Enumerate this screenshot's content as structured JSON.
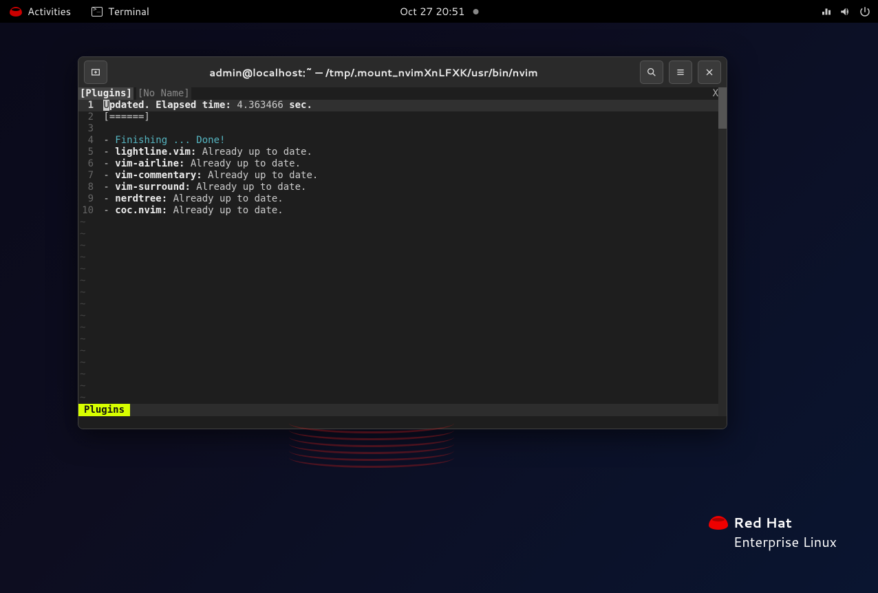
{
  "topbar": {
    "activities": "Activities",
    "app": "Terminal",
    "clock": "Oct 27  20:51"
  },
  "terminal": {
    "title": "admin@localhost:~ — /tmp/.mount_nvimXnLFXK/usr/bin/nvim",
    "tabs": {
      "active": "[Plugins]",
      "inactive": "[No Name]",
      "close": "X"
    },
    "lines": [
      {
        "n": "1",
        "html": "<span class='cursor-block'>U</span><span class='bold'>pdated. Elapsed time:</span> 4.363466 <span class='bold'>sec.</span>",
        "current": true
      },
      {
        "n": "2",
        "html": "[======]"
      },
      {
        "n": "3",
        "html": ""
      },
      {
        "n": "4",
        "html": "- <span class='cyan'>Finishing ... Done!</span>"
      },
      {
        "n": "5",
        "html": "- <span class='bold'>lightline.vim:</span> Already up to date."
      },
      {
        "n": "6",
        "html": "- <span class='bold'>vim-airline:</span> Already up to date."
      },
      {
        "n": "7",
        "html": "- <span class='bold'>vim-commentary:</span> Already up to date."
      },
      {
        "n": "8",
        "html": "- <span class='bold'>vim-surround:</span> Already up to date."
      },
      {
        "n": "9",
        "html": "- <span class='bold'>nerdtree:</span> Already up to date."
      },
      {
        "n": "10",
        "html": "- <span class='bold'>coc.nvim:</span> Already up to date."
      }
    ],
    "status_mode": "Plugins",
    "tilde_count": 16
  },
  "watermark": {
    "brand": "Red Hat",
    "product": "Enterprise Linux"
  }
}
